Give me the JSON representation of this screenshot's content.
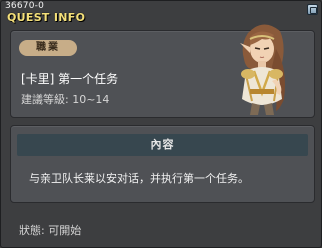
{
  "window": {
    "quest_id": "36670-0",
    "title": "QUEST INFO"
  },
  "job": {
    "badge": "職業",
    "name": "[卡里] 第一个任务",
    "level_req": "建議等級: 10~14"
  },
  "content": {
    "header": "內容",
    "text": "与亲卫队长莱以安对话，并执行第一个任务。"
  },
  "status": "狀態: 可開始",
  "colors": {
    "title": "#f4e07a",
    "badge_bg": "#c7ad88",
    "panel_bg": "#4f5155",
    "content_header_bg": "#37474f"
  },
  "icons": {
    "close": "close-icon",
    "portrait": "npc-portrait"
  }
}
